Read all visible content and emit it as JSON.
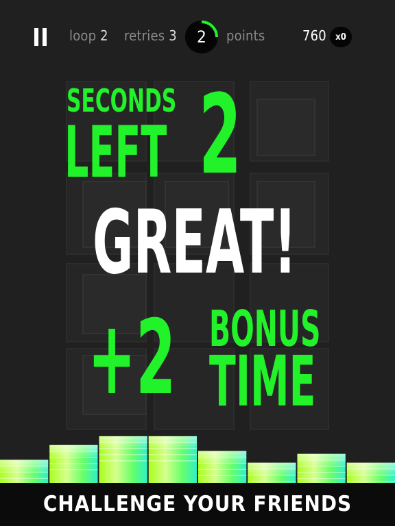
{
  "hud": {
    "loop_label": "loop",
    "loop_value": "2",
    "retries_label": "retries",
    "retries_value": "3",
    "timer_value": "2",
    "timer_fraction": 0.25,
    "points_label": "points",
    "score": "760",
    "multiplier": "x0"
  },
  "overlay": {
    "seconds_label": "SECONDS",
    "left_label": "LEFT",
    "seconds_value": "2",
    "message": "GREAT!",
    "bonus_value": "+2",
    "bonus_label": "BONUS",
    "time_label": "TIME"
  },
  "colors": {
    "accent_green": "#22f22a",
    "background": "#202020"
  },
  "icons": [
    "pause-icon"
  ],
  "equalizer_levels": [
    0.45,
    0.7,
    0.85,
    0.85,
    0.6,
    0.4,
    0.55,
    0.4
  ],
  "banner": {
    "text": "CHALLENGE YOUR FRIENDS"
  }
}
